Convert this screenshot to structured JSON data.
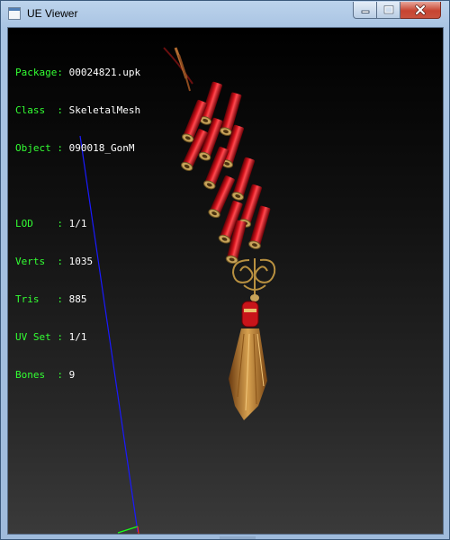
{
  "window": {
    "title": "UE Viewer",
    "controls": {
      "minimize": "minimize-icon",
      "maximize": "maximize-icon",
      "close": "close-icon"
    }
  },
  "info": {
    "package": {
      "label": "Package:",
      "value": "00024821.upk"
    },
    "class": {
      "label": "Class  :",
      "value": "SkeletalMesh"
    },
    "object": {
      "label": "Object :",
      "value": "090018_GonM"
    },
    "lod": {
      "label": "LOD    :",
      "value": "1/1"
    },
    "verts": {
      "label": "Verts  :",
      "value": "1035"
    },
    "tris": {
      "label": "Tris   :",
      "value": "885"
    },
    "uvset": {
      "label": "UV Set :",
      "value": "1/1"
    },
    "bones": {
      "label": "Bones  :",
      "value": "9"
    }
  },
  "colors": {
    "label_text": "#33ff33",
    "value_text": "#ffffff",
    "firecracker_red": "#c8141a",
    "brass_cap": "#c7a35a",
    "tassel_gold": "#c08a3a",
    "axis_blue": "#1a1aff",
    "axis_green": "#19ff19",
    "axis_red": "#ff2020"
  }
}
